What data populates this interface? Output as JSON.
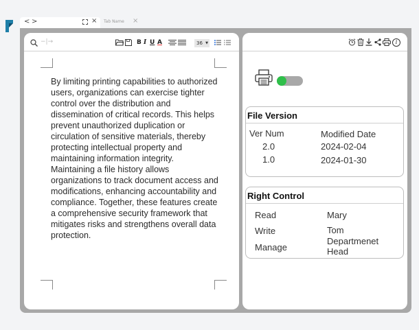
{
  "tabs": {
    "active": {
      "back": "<",
      "forward": ">",
      "close": "×"
    },
    "inactive": {
      "label": "Tab Name",
      "close": "×"
    }
  },
  "toolbar": {
    "search_icon": "search-icon",
    "nav_disabled": "−|→",
    "font_size": "36",
    "bold": "B",
    "italic": "I",
    "underline": "U",
    "font_color": "A"
  },
  "document": {
    "body": "By limiting printing capabilities to authorized users, organizations can exercise tighter control over the distribution and dissemination of critical records. This helps prevent unauthorized duplication or circulation of sensitive materials, thereby protecting intellectual property and maintaining information integrity. Maintaining a file history allows organizations to track document access and modifications, enhancing accountability and compliance. Together, these features create a comprehensive security framework that mitigates risks and strengthens overall data protection."
  },
  "print_permission": {
    "enabled": true,
    "accent": "#2fbf4a"
  },
  "file_version": {
    "title": "File Version",
    "headers": [
      "Ver Num",
      "Modified Date"
    ],
    "rows": [
      {
        "ver": "2.0",
        "date": "2024-02-04"
      },
      {
        "ver": "1.0",
        "date": "2024-01-30"
      }
    ]
  },
  "right_control": {
    "title": "Right Control",
    "rows": [
      {
        "right": "Read",
        "user": "Mary"
      },
      {
        "right": "Write",
        "user": "Tom"
      },
      {
        "right": "Manage",
        "user_line1": "Departmenet",
        "user_line2": "Head"
      }
    ]
  },
  "colors": {
    "brand_logo": "#1e7fa8",
    "frame": "#a8a8a8"
  }
}
